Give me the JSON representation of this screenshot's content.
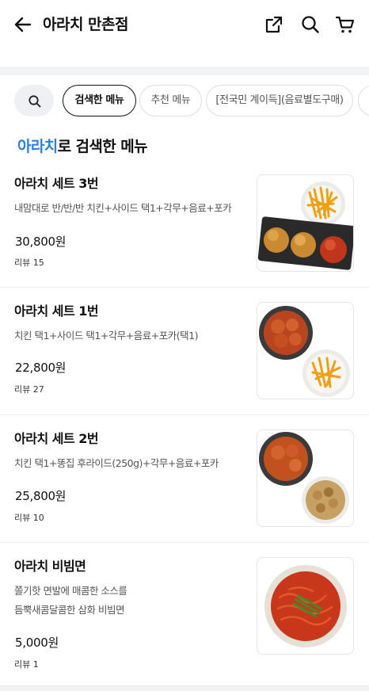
{
  "header": {
    "title": "아라치 만촌점",
    "icons": [
      "back-arrow-icon",
      "share-icon",
      "search-icon",
      "cart-icon"
    ]
  },
  "chips": [
    {
      "label": "검색한 메뉴",
      "selected": true
    },
    {
      "label": "추천 메뉴",
      "selected": false
    },
    {
      "label": "[전국민 계이득](음료별도구매)",
      "selected": false
    },
    {
      "label": "",
      "selected": false
    }
  ],
  "heading": {
    "keyword": "아라치",
    "suffix": "로 검색한 메뉴"
  },
  "colors": {
    "accent": "#2a7fe0",
    "divider": "#eceef0",
    "band": "#f1f3f5"
  },
  "items": [
    {
      "name": "아라치 세트 3번",
      "desc": [
        "내맘대로 반/반/반 치킨+사이드 택1+각무+음료+포카"
      ],
      "price": "30,800원",
      "review": "리뷰 15"
    },
    {
      "name": "아라치 세트 1번",
      "desc": [
        "치킨 택1+사이드 택1+각무+음료+포카(택1)"
      ],
      "price": "22,800원",
      "review": "리뷰 27"
    },
    {
      "name": "아라치 세트 2번",
      "desc": [
        "치킨 택1+똥집 후라이드(250g)+각무+음료+포카"
      ],
      "price": "25,800원",
      "review": "리뷰 10"
    },
    {
      "name": "아라치 비빔면",
      "desc": [
        "쫄기핫 면발에 매콤한 소스를",
        "듬뿍새콤달콤한 삼화 비빔면"
      ],
      "price": "5,000원",
      "review": "리뷰 1"
    }
  ]
}
